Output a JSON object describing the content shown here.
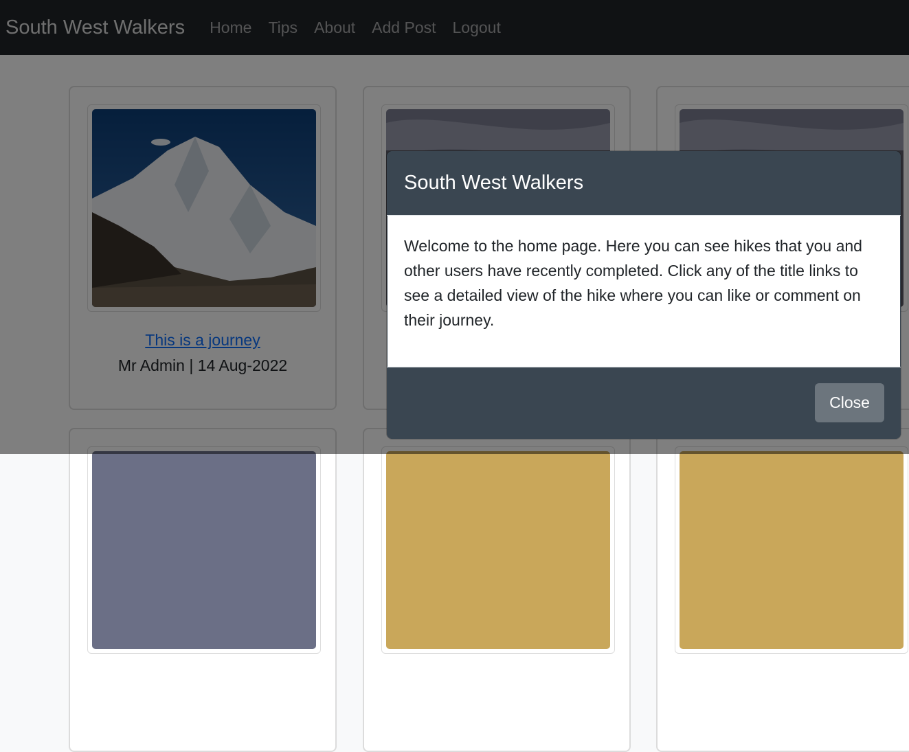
{
  "nav": {
    "brand": "South West Walkers",
    "links": [
      "Home",
      "Tips",
      "About",
      "Add Post",
      "Logout"
    ]
  },
  "posts": [
    {
      "title": "This is a journey",
      "meta": "Mr Admin | 14 Aug-2022"
    }
  ],
  "modal": {
    "title": "South West Walkers",
    "body": "Welcome to the home page. Here you can see hikes that you and other users have recently completed. Click any of the title links to see a detailed view of the hike where you can like or comment on their journey.",
    "close_label": "Close"
  },
  "colors": {
    "navbar": "#212529",
    "modal_header": "#3a4651",
    "link": "#0d6efd",
    "button": "#6c757d"
  }
}
